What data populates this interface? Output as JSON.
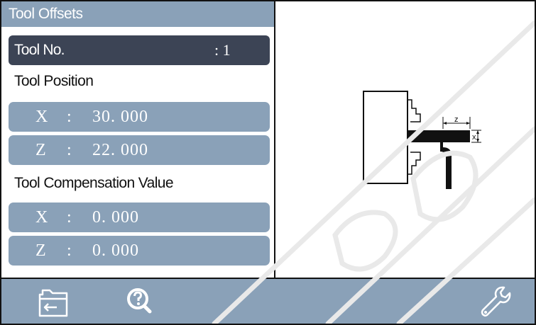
{
  "panel": {
    "title": "Tool Offsets"
  },
  "tool_no": {
    "label": "Tool No.",
    "value": ": 1"
  },
  "tool_position": {
    "heading": "Tool Position",
    "x_axis": "X",
    "x_sep": ":",
    "x_value": "30. 000",
    "z_axis": "Z",
    "z_sep": ":",
    "z_value": "22. 000"
  },
  "tool_compensation": {
    "heading": "Tool Compensation Value",
    "x_axis": "X",
    "x_sep": ":",
    "x_value": "0. 000",
    "z_axis": "Z",
    "z_sep": ":",
    "z_value": "0. 000"
  },
  "diagram": {
    "z_label": "z",
    "x_label": "x"
  },
  "toolbar": {
    "icons": [
      "folder-back-icon",
      "search-help-icon",
      "wrench-icon"
    ]
  },
  "colors": {
    "accent": "#8aa1b8",
    "dark_bar": "#3c4455",
    "border": "#111111"
  }
}
